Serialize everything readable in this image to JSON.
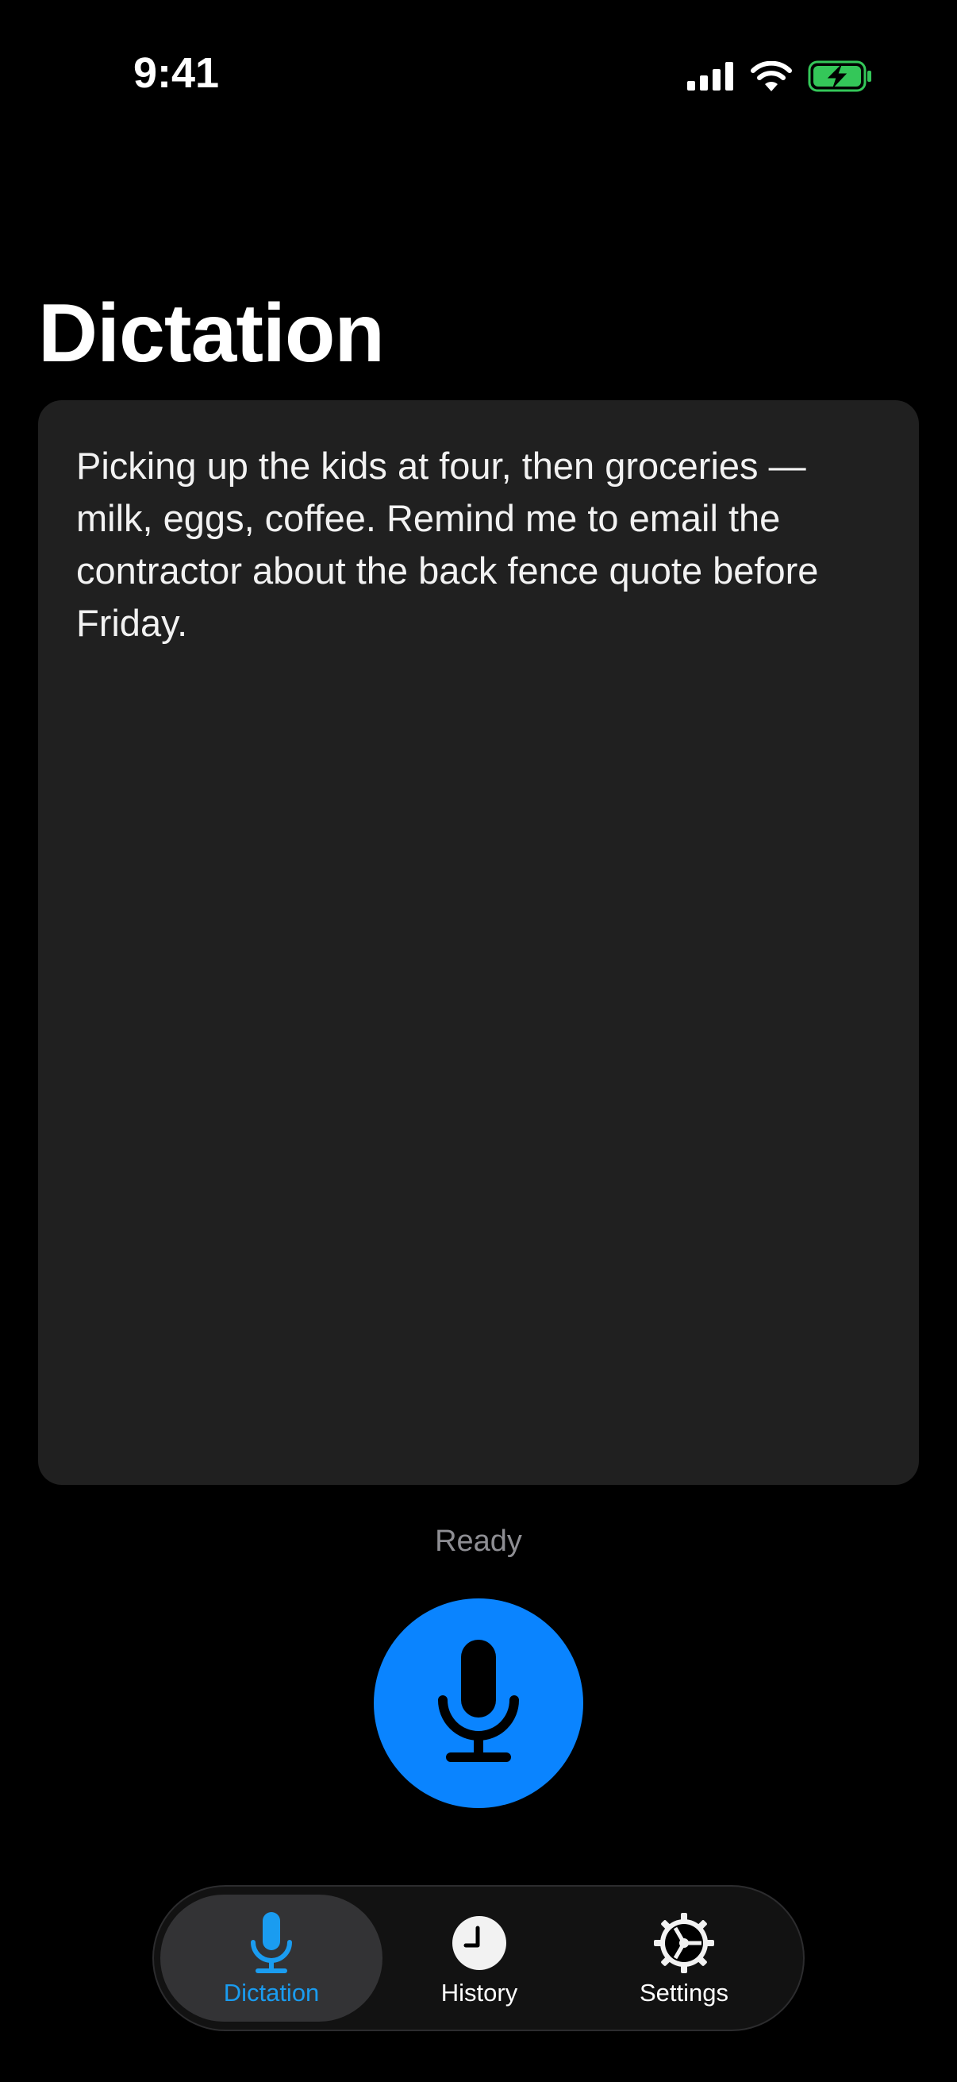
{
  "status_bar": {
    "time": "9:41",
    "icons": [
      "cellular-signal-icon",
      "wifi-icon",
      "battery-charging-icon"
    ],
    "battery_color": "#34c759"
  },
  "page": {
    "title": "Dictation"
  },
  "transcript": {
    "text": "Picking up the kids at four, then groceries — milk, eggs, coffee. Remind me to email the contractor about the back fence quote before Friday."
  },
  "recorder": {
    "status": "Ready",
    "mic_button_icon": "microphone-icon",
    "accent_color": "#0a84ff"
  },
  "tab_bar": {
    "tabs": [
      {
        "label": "Dictation",
        "icon": "microphone-icon",
        "active": true
      },
      {
        "label": "History",
        "icon": "clock-icon",
        "active": false
      },
      {
        "label": "Settings",
        "icon": "gear-icon",
        "active": false
      }
    ],
    "active_color": "#1a9cf0"
  }
}
